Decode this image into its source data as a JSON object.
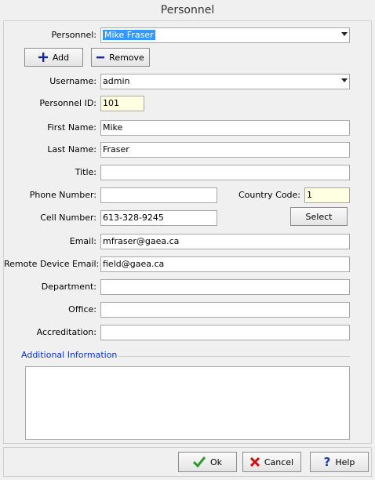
{
  "window": {
    "title": "Personnel"
  },
  "personnel": {
    "label": "Personnel:",
    "value": "Mike Fraser"
  },
  "actions": {
    "add_label": "Add",
    "remove_label": "Remove"
  },
  "username": {
    "label": "Username:",
    "value": "admin"
  },
  "personnel_id": {
    "label": "Personnel ID:",
    "value": "101"
  },
  "first_name": {
    "label": "First Name:",
    "value": "Mike"
  },
  "last_name": {
    "label": "Last Name:",
    "value": "Fraser"
  },
  "title_field": {
    "label": "Title:",
    "value": ""
  },
  "phone": {
    "label": "Phone Number:",
    "value": ""
  },
  "country_code": {
    "label": "Country Code:",
    "value": "1"
  },
  "cell": {
    "label": "Cell Number:",
    "value": "613-328-9245"
  },
  "select_button": {
    "label": "Select"
  },
  "email": {
    "label": "Email:",
    "value": "mfraser@gaea.ca"
  },
  "remote_email": {
    "label": "Remote Device Email:",
    "value": "field@gaea.ca"
  },
  "department": {
    "label": "Department:",
    "value": ""
  },
  "office": {
    "label": "Office:",
    "value": ""
  },
  "accreditation": {
    "label": "Accreditation:",
    "value": ""
  },
  "additional": {
    "label": "Additional Information",
    "value": ""
  },
  "footer": {
    "ok_label": "Ok",
    "cancel_label": "Cancel",
    "help_label": "Help"
  },
  "colors": {
    "accent_blue": "#0033cc",
    "highlight": "#3399ff",
    "readonly_yellow": "#ffffe1",
    "cancel_red": "#cc1111",
    "ok_green": "#2a9a2a"
  }
}
